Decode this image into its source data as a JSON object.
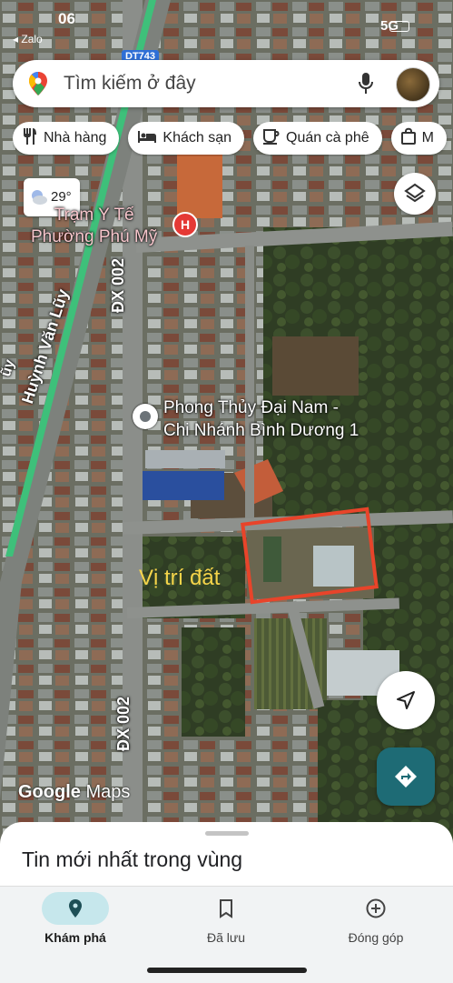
{
  "status_bar": {
    "time": "06",
    "back_app": "◂ Zalo",
    "network": "5G"
  },
  "search": {
    "placeholder": "Tìm kiếm ở đây"
  },
  "chips": [
    {
      "label": "Nhà hàng",
      "icon": "restaurant-icon"
    },
    {
      "label": "Khách sạn",
      "icon": "hotel-icon"
    },
    {
      "label": "Quán cà phê",
      "icon": "coffee-icon"
    },
    {
      "label": "M",
      "icon": "shopping-icon"
    }
  ],
  "weather": {
    "temperature": "29°",
    "icon": "partly-cloudy-icon"
  },
  "map": {
    "route_shield": "DT743",
    "hospital": {
      "label_line1": "Trạm Y Tế",
      "label_line2": "Phường Phú Mỹ",
      "marker": "H"
    },
    "place": {
      "label_line1": "Phong Thủy Đại Nam -",
      "label_line2": "Chi Nhánh Bình Dương 1"
    },
    "roads": {
      "huynh_van_luy": "Huỳnh Văn Lũy",
      "dx002_top": "ĐX 002",
      "dx002_bottom": "ĐX 002",
      "side_fragment": "ũy"
    },
    "annotation": {
      "text": "Vị trí đất",
      "box_color": "#e8442a"
    },
    "attribution": {
      "brand": "Google",
      "product": "Maps"
    }
  },
  "sheet": {
    "title": "Tin mới nhất trong vùng"
  },
  "bottom_nav": [
    {
      "label": "Khám phá",
      "icon": "explore-pin-icon",
      "active": true
    },
    {
      "label": "Đã lưu",
      "icon": "bookmark-icon",
      "active": false
    },
    {
      "label": "Đóng góp",
      "icon": "add-circle-icon",
      "active": false
    }
  ],
  "colors": {
    "accent": "#1e6b75",
    "nav_active": "#c6e7ec",
    "road_green": "#3ec07a"
  }
}
